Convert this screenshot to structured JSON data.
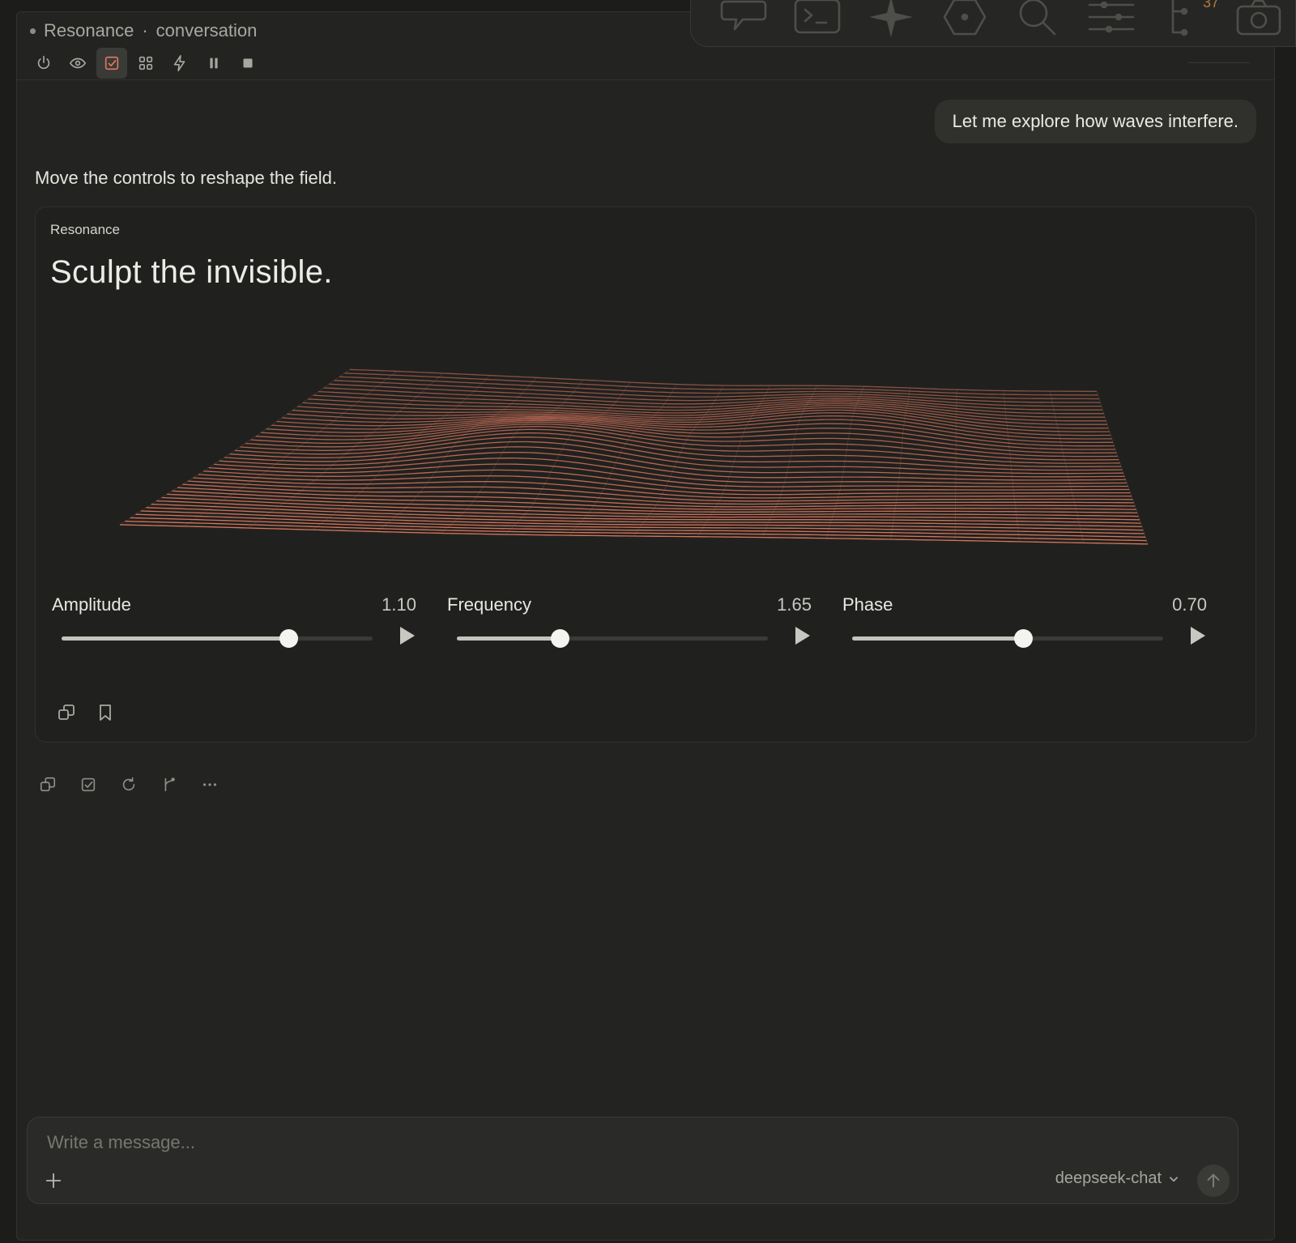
{
  "window": {
    "title": "Resonance",
    "separator": "·",
    "subtitle": "conversation"
  },
  "toolbar": {
    "buttons": [
      {
        "name": "power-icon",
        "active": false
      },
      {
        "name": "eye-icon",
        "active": false
      },
      {
        "name": "checkbox-icon",
        "active": true
      },
      {
        "name": "grid-icon",
        "active": false
      },
      {
        "name": "bolt-icon",
        "active": false
      },
      {
        "name": "pause-icon",
        "active": false
      },
      {
        "name": "stop-icon",
        "active": false
      }
    ]
  },
  "dock": {
    "icons": [
      "chat-bubble-icon",
      "terminal-icon",
      "sparkle-icon",
      "hexagon-icon",
      "search-icon",
      "sliders-icon",
      "tree-icon",
      "camera-icon"
    ],
    "badge": "37"
  },
  "conversation": {
    "user_message": "Let me explore how waves interfere.",
    "assistant_message": "Move the controls to reshape the field."
  },
  "card": {
    "kicker": "Resonance",
    "title": "Sculpt the invisible.",
    "controls": [
      {
        "label": "Amplitude",
        "value": "1.10",
        "position": 0.73
      },
      {
        "label": "Frequency",
        "value": "1.65",
        "position": 0.33
      },
      {
        "label": "Phase",
        "value": "0.70",
        "position": 0.55
      }
    ],
    "actions": [
      "copy-icon",
      "bookmark-icon"
    ]
  },
  "message_actions": [
    "copy-icon",
    "checkbox-icon",
    "retry-icon",
    "branch-icon",
    "more-icon"
  ],
  "composer": {
    "placeholder": "Write a message...",
    "model": "deepseek-chat"
  },
  "colors": {
    "accent": "#e07a5f",
    "background": "#232421",
    "card": "#20211f"
  }
}
